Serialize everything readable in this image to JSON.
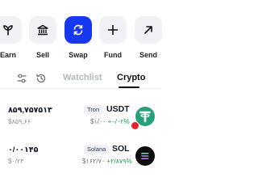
{
  "actions": [
    {
      "label": "Earn",
      "icon": "sprout-icon"
    },
    {
      "label": "Sell",
      "icon": "bank-icon"
    },
    {
      "label": "Swap",
      "icon": "swap-icon"
    },
    {
      "label": "Fund",
      "icon": "plus-icon"
    },
    {
      "label": "Send",
      "icon": "arrow-up-right-icon"
    }
  ],
  "tabs": {
    "watchlist": "Watchlist",
    "crypto": "Crypto",
    "active": "Crypto"
  },
  "assets": [
    {
      "amount": "۸۵۹,۷۵۷۵۱۳",
      "fiat": "$۸۵۹,۶۶",
      "network": "Tron",
      "symbol": "USDT",
      "price": "$۱/۰۰",
      "change": "+۰/۰۲%",
      "icon": "tether-icon"
    },
    {
      "amount": "۰/۰۰۱۴۵",
      "fiat": "$۰/۲۳",
      "network": "Solana",
      "symbol": "SOL",
      "price": "$۱۶۲/۷۰",
      "change": "+۲/۸۷۹%",
      "icon": "solana-icon"
    }
  ],
  "colors": {
    "accent": "#1738f0",
    "positive": "#16a34a",
    "tether": "#26a17b"
  }
}
